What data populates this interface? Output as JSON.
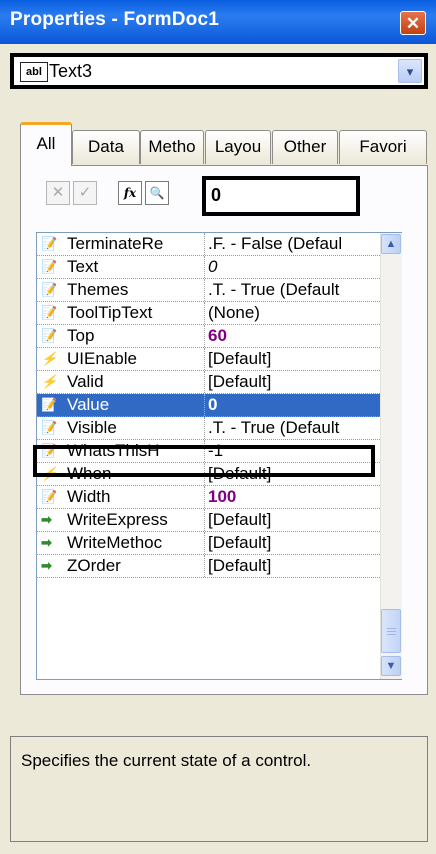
{
  "window": {
    "title": "Properties - FormDoc1",
    "close_glyph": "✕"
  },
  "object_selector": {
    "icon_label": "abl",
    "value": "Text3",
    "arrow_glyph": "▾"
  },
  "tabs": [
    {
      "label": "All",
      "active": true
    },
    {
      "label": "Data",
      "active": false
    },
    {
      "label": "Metho",
      "active": false
    },
    {
      "label": "Layou",
      "active": false
    },
    {
      "label": "Other",
      "active": false
    },
    {
      "label": "Favori",
      "active": false
    }
  ],
  "toolbar": {
    "cancel_glyph": "✕",
    "accept_glyph": "✓",
    "function_glyph": "fx",
    "zoom_glyph": "🔍",
    "input_value": "0"
  },
  "properties": [
    {
      "icon": "property-icon",
      "name": "TerminateRe",
      "value": ".F. - False (Defaul",
      "style": ""
    },
    {
      "icon": "property-icon",
      "name": "Text",
      "value": "0",
      "style": "ital"
    },
    {
      "icon": "property-icon",
      "name": "Themes",
      "value": ".T. - True (Default",
      "style": ""
    },
    {
      "icon": "property-icon",
      "name": "ToolTipText",
      "value": "(None)",
      "style": ""
    },
    {
      "icon": "property-icon",
      "name": "Top",
      "value": "60",
      "style": "purple"
    },
    {
      "icon": "event-icon",
      "name": "UIEnable",
      "value": "[Default]",
      "style": ""
    },
    {
      "icon": "event-icon",
      "name": "Valid",
      "value": "[Default]",
      "style": ""
    },
    {
      "icon": "property-icon",
      "name": "Value",
      "value": "0",
      "style": "bold",
      "selected": true
    },
    {
      "icon": "property-icon",
      "name": "Visible",
      "value": ".T. - True (Default",
      "style": ""
    },
    {
      "icon": "property-icon",
      "name": "WhatsThisH",
      "value": "-1",
      "style": ""
    },
    {
      "icon": "event-icon",
      "name": "When",
      "value": "[Default]",
      "style": ""
    },
    {
      "icon": "property-icon",
      "name": "Width",
      "value": "100",
      "style": "purple"
    },
    {
      "icon": "method-icon",
      "name": "WriteExpress",
      "value": "[Default]",
      "style": ""
    },
    {
      "icon": "method-icon",
      "name": "WriteMethoc",
      "value": "[Default]",
      "style": ""
    },
    {
      "icon": "method-icon",
      "name": "ZOrder",
      "value": "[Default]",
      "style": ""
    }
  ],
  "scrollbar": {
    "up_glyph": "▲",
    "down_glyph": "▼"
  },
  "description": "Specifies the current state of a control.",
  "colors": {
    "titlebar": "#1f6fe6",
    "selection": "#316ac5",
    "user_value": "#800080",
    "tab_accent": "#f5a623"
  }
}
